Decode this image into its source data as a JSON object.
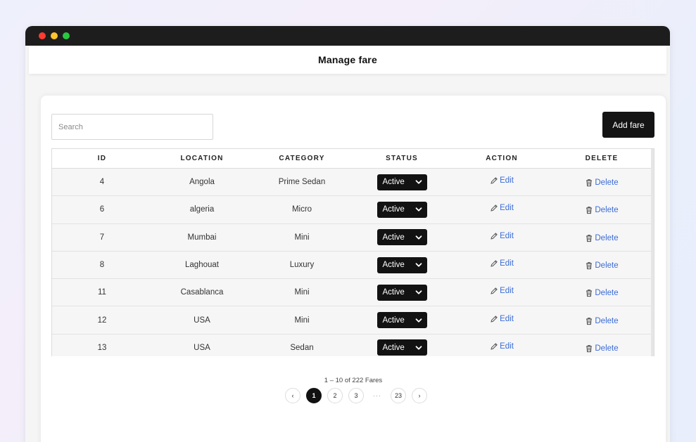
{
  "header": {
    "title": "Manage fare"
  },
  "toolbar": {
    "search_placeholder": "Search",
    "add_label": "Add fare"
  },
  "table": {
    "columns": [
      "ID",
      "LOCATION",
      "CATEGORY",
      "STATUS",
      "ACTION",
      "DELETE"
    ],
    "edit_label": "Edit",
    "delete_label": "Delete",
    "rows": [
      {
        "id": "4",
        "location": "Angola",
        "category": "Prime Sedan",
        "status": "Active"
      },
      {
        "id": "6",
        "location": "algeria",
        "category": "Micro",
        "status": "Active"
      },
      {
        "id": "7",
        "location": "Mumbai",
        "category": "Mini",
        "status": "Active"
      },
      {
        "id": "8",
        "location": "Laghouat",
        "category": "Luxury",
        "status": "Active"
      },
      {
        "id": "11",
        "location": "Casablanca",
        "category": "Mini",
        "status": "Active"
      },
      {
        "id": "12",
        "location": "USA",
        "category": "Mini",
        "status": "Active"
      },
      {
        "id": "13",
        "location": "USA",
        "category": "Sedan",
        "status": "Active"
      }
    ]
  },
  "pagination": {
    "info": "1 – 10 of 222 Fares",
    "prev": "‹",
    "next": "›",
    "pages": [
      "1",
      "2",
      "3"
    ],
    "ellipsis": "···",
    "last": "23",
    "current": "1"
  },
  "icons": {
    "edit": "pencil-icon",
    "delete": "trash-icon",
    "status": "chevron-down-icon"
  },
  "colors": {
    "accent": "#3b6cd6",
    "dark": "#121212"
  }
}
